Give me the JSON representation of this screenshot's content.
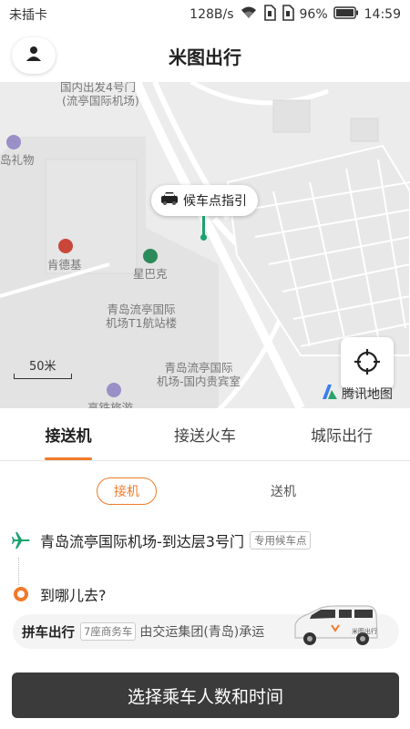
{
  "status_bar": {
    "carrier": "未插卡",
    "net_speed": "128B/s",
    "battery": "96%",
    "time": "14:59"
  },
  "header": {
    "title": "米图出行"
  },
  "map": {
    "labels": {
      "domestic_departure": "国内出发4号门",
      "domestic_departure_sub": "(流亭国际机场)",
      "gift_shop": "岛礼物",
      "kfc": "肯德基",
      "starbucks": "星巴克",
      "terminal_t1": "青岛流亭国际\n机场T1航站楼",
      "vip_room": "青岛流亭国际\n机场-国内贵宾室",
      "bottom_cut": "高铁旅游"
    },
    "pickup_bubble": "候车点指引",
    "scale": "50米",
    "brand": "腾讯地图",
    "pin_color": "#1aa36f"
  },
  "tabs": {
    "items": [
      {
        "label": "接送机",
        "active": true
      },
      {
        "label": "接送火车",
        "active": false
      },
      {
        "label": "城际出行",
        "active": false
      }
    ]
  },
  "subtabs": {
    "pickup": "接机",
    "dropoff": "送机"
  },
  "route": {
    "from": "青岛流亭国际机场-到达层3号门",
    "from_tag": "专用候车点",
    "to_placeholder": "到哪儿去?"
  },
  "promo": {
    "title": "拼车出行",
    "tag": "7座商务车",
    "text": "由交运集团(青岛)承运",
    "van_brand": "米图出行"
  },
  "cta": {
    "label": "选择乘车人数和时间"
  },
  "colors": {
    "accent": "#f07a2a",
    "button_bg": "#3b3b3b",
    "plane": "#1aa36f"
  }
}
